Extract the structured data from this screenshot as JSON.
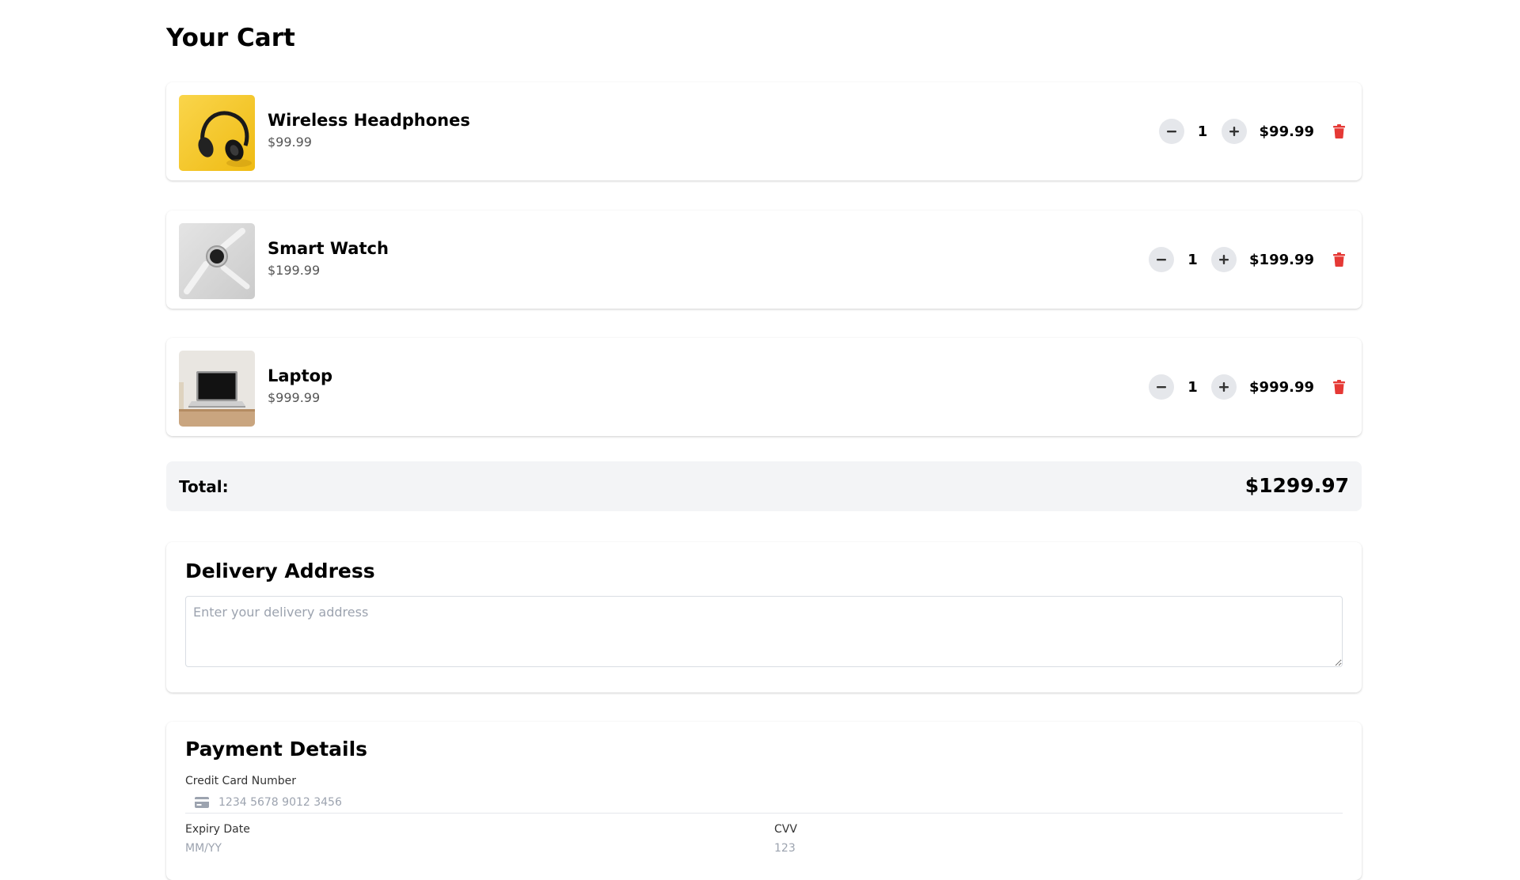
{
  "page": {
    "title": "Your Cart"
  },
  "cart": {
    "items": [
      {
        "name": "Wireless Headphones",
        "unit_price": "$99.99",
        "quantity": "1",
        "line_total": "$99.99",
        "image": "headphones-image"
      },
      {
        "name": "Smart Watch",
        "unit_price": "$199.99",
        "quantity": "1",
        "line_total": "$199.99",
        "image": "smartwatch-image"
      },
      {
        "name": "Laptop",
        "unit_price": "$999.99",
        "quantity": "1",
        "line_total": "$999.99",
        "image": "laptop-image"
      }
    ],
    "total_label": "Total:",
    "total_value": "$1299.97"
  },
  "delivery": {
    "title": "Delivery Address",
    "address_placeholder": "Enter your delivery address",
    "address_value": ""
  },
  "payment": {
    "title": "Payment Details",
    "card_number_label": "Credit Card Number",
    "card_number_placeholder": "1234 5678 9012 3456",
    "card_icon": "credit-card-icon",
    "expiry_label": "Expiry Date",
    "expiry_placeholder": "MM/YY",
    "cvv_label": "CVV",
    "cvv_placeholder": "123"
  },
  "icons": {
    "decrement": "minus-icon",
    "increment": "plus-icon",
    "remove": "trash-icon"
  },
  "colors": {
    "accent_delete": "#e53935",
    "qty_button_bg": "#e5e7eb",
    "total_bar_bg": "#f3f4f6",
    "muted_text": "#555555",
    "placeholder": "#9ca3af"
  }
}
